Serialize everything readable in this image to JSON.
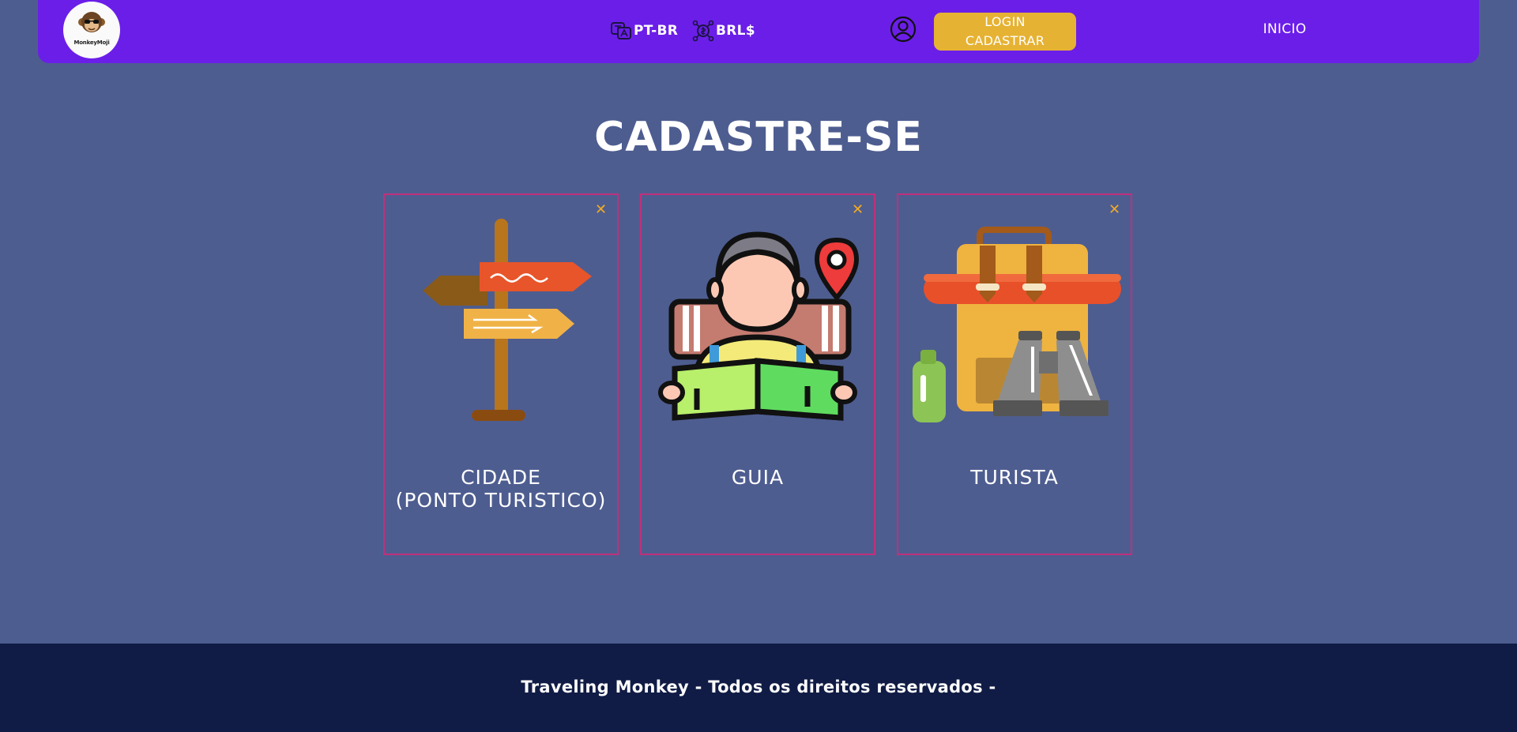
{
  "header": {
    "logo": {
      "text": "MonkeyMoji",
      "icon": "monkey-logo-icon"
    },
    "language": {
      "label": "PT-BR",
      "icon": "language-icon"
    },
    "currency": {
      "label": "BRL$",
      "icon": "currency-icon"
    },
    "user_icon": "user-circle-icon",
    "auth_button": {
      "line1": "LOGIN",
      "line2": "CADASTRAR"
    },
    "nav_link": "INICIO"
  },
  "main": {
    "title": "CADASTRE-SE",
    "cards": [
      {
        "line1": "CIDADE",
        "line2": "(PONTO TURISTICO)",
        "icon": "signpost-icon",
        "close_icon": "close-icon"
      },
      {
        "line1": "GUIA",
        "line2": "",
        "icon": "tour-guide-icon",
        "close_icon": "close-icon"
      },
      {
        "line1": "TURISTA",
        "line2": "",
        "icon": "backpack-binoculars-icon",
        "close_icon": "close-icon"
      }
    ]
  },
  "footer": {
    "text": "Traveling Monkey - Todos os direitos reservados -"
  },
  "colors": {
    "background": "#4e5d90",
    "navbar": "#6b1ee8",
    "auth_button": "#e6b233",
    "card_border": "#c0307b",
    "close_icon": "#f2ab24",
    "footer": "#101c45"
  }
}
